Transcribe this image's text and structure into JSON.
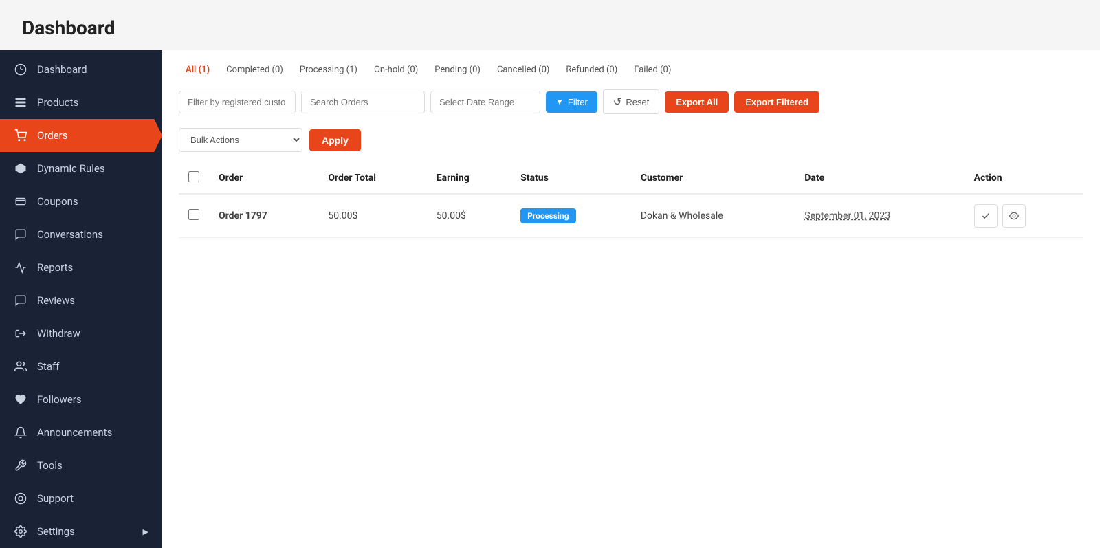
{
  "page": {
    "title": "Dashboard"
  },
  "sidebar": {
    "items": [
      {
        "id": "dashboard",
        "label": "Dashboard",
        "icon": "⏱",
        "active": false
      },
      {
        "id": "products",
        "label": "Products",
        "icon": "💼",
        "active": false
      },
      {
        "id": "orders",
        "label": "Orders",
        "icon": "🛒",
        "active": true
      },
      {
        "id": "dynamic-rules",
        "label": "Dynamic Rules",
        "icon": "⬡",
        "active": false
      },
      {
        "id": "coupons",
        "label": "Coupons",
        "icon": "🎁",
        "active": false
      },
      {
        "id": "conversations",
        "label": "Conversations",
        "icon": "💬",
        "active": false
      },
      {
        "id": "reports",
        "label": "Reports",
        "icon": "📈",
        "active": false
      },
      {
        "id": "reviews",
        "label": "Reviews",
        "icon": "💬",
        "active": false
      },
      {
        "id": "withdraw",
        "label": "Withdraw",
        "icon": "⬆",
        "active": false
      },
      {
        "id": "staff",
        "label": "Staff",
        "icon": "👥",
        "active": false
      },
      {
        "id": "followers",
        "label": "Followers",
        "icon": "♥",
        "active": false
      },
      {
        "id": "announcements",
        "label": "Announcements",
        "icon": "🔔",
        "active": false
      },
      {
        "id": "tools",
        "label": "Tools",
        "icon": "🔧",
        "active": false
      },
      {
        "id": "support",
        "label": "Support",
        "icon": "⊙",
        "active": false
      },
      {
        "id": "settings",
        "label": "Settings",
        "icon": "⚙",
        "active": false
      }
    ]
  },
  "status_tabs": [
    {
      "id": "all",
      "label": "All (1)",
      "active": true
    },
    {
      "id": "completed",
      "label": "Completed (0)",
      "active": false
    },
    {
      "id": "processing",
      "label": "Processing (1)",
      "active": false
    },
    {
      "id": "on-hold",
      "label": "On-hold (0)",
      "active": false
    },
    {
      "id": "pending",
      "label": "Pending (0)",
      "active": false
    },
    {
      "id": "cancelled",
      "label": "Cancelled (0)",
      "active": false
    },
    {
      "id": "refunded",
      "label": "Refunded (0)",
      "active": false
    },
    {
      "id": "failed",
      "label": "Failed (0)",
      "active": false
    }
  ],
  "filters": {
    "customer_placeholder": "Filter by registered custo",
    "search_placeholder": "Search Orders",
    "date_placeholder": "Select Date Range",
    "filter_label": "Filter",
    "reset_label": "Reset",
    "export_all_label": "Export All",
    "export_filtered_label": "Export Filtered"
  },
  "bulk": {
    "placeholder": "Bulk Actions",
    "apply_label": "Apply"
  },
  "table": {
    "columns": [
      "",
      "Order",
      "Order Total",
      "Earning",
      "Status",
      "Customer",
      "Date",
      "Action"
    ],
    "rows": [
      {
        "id": "order-1797",
        "order": "Order 1797",
        "order_total": "50.00$",
        "earning": "50.00$",
        "status": "Processing",
        "customer": "Dokan & Wholesale",
        "date": "September 01, 2023"
      }
    ]
  }
}
